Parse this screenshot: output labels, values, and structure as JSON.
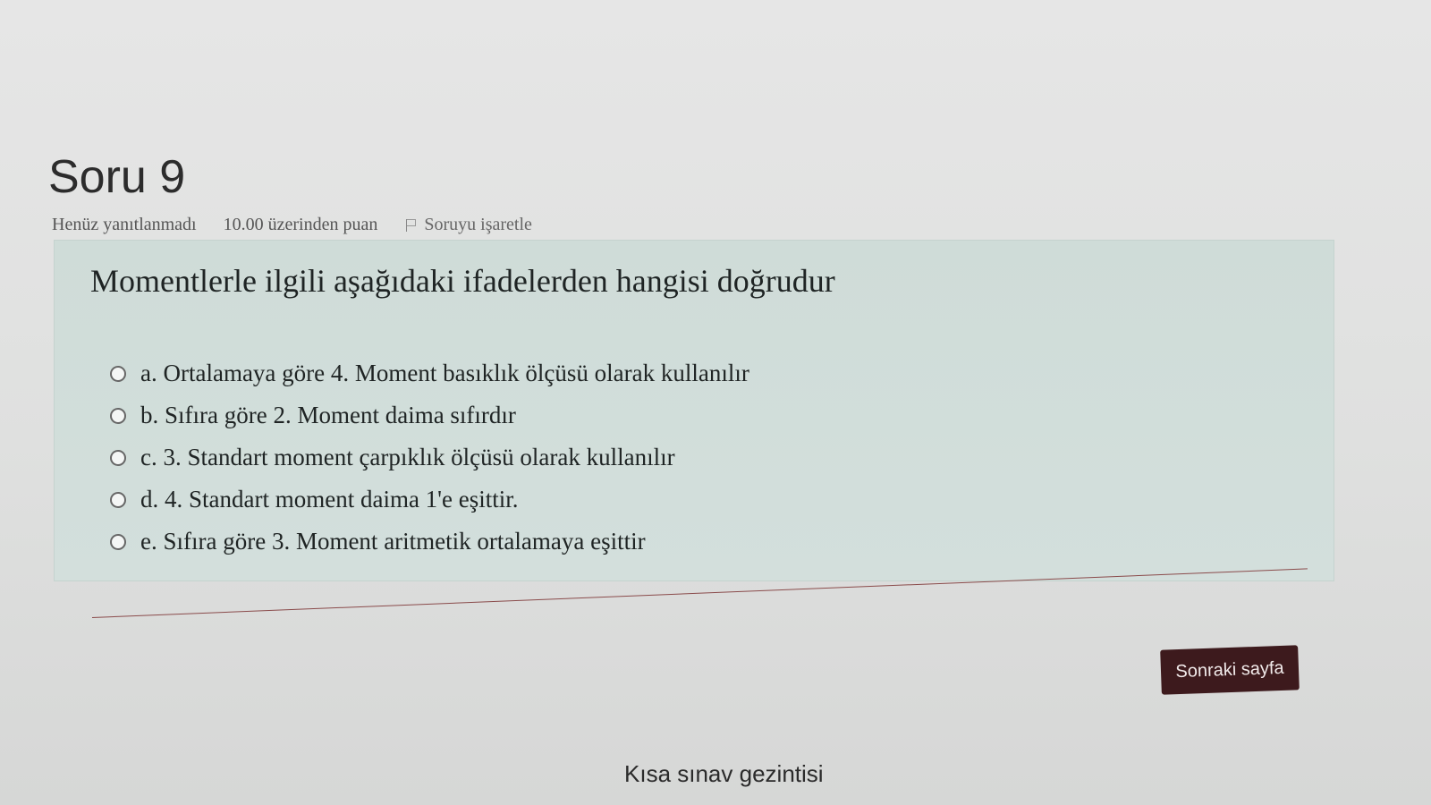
{
  "question": {
    "title": "Soru 9",
    "status": "Henüz yanıtlanmadı",
    "points": "10.00 üzerinden puan",
    "flag_label": "Soruyu işaretle",
    "text": "Momentlerle ilgili aşağıdaki ifadelerden hangisi doğrudur",
    "answers": [
      {
        "label": "a. Ortalamaya göre 4. Moment basıklık ölçüsü olarak kullanılır"
      },
      {
        "label": "b. Sıfıra göre 2. Moment daima sıfırdır"
      },
      {
        "label": "c. 3. Standart moment çarpıklık ölçüsü olarak kullanılır"
      },
      {
        "label": "d. 4. Standart moment daima 1'e eşittir."
      },
      {
        "label": "e. Sıfıra göre 3. Moment aritmetik ortalamaya eşittir"
      }
    ]
  },
  "navigation": {
    "next_button": "Sonraki sayfa",
    "quiz_nav_title": "Kısa sınav gezintisi"
  },
  "colors": {
    "question_bg": "#cfdcd8",
    "next_button_bg": "#3d1a1d"
  },
  "icons": {
    "flag": "flag-icon",
    "radio": "radio-unselected"
  }
}
